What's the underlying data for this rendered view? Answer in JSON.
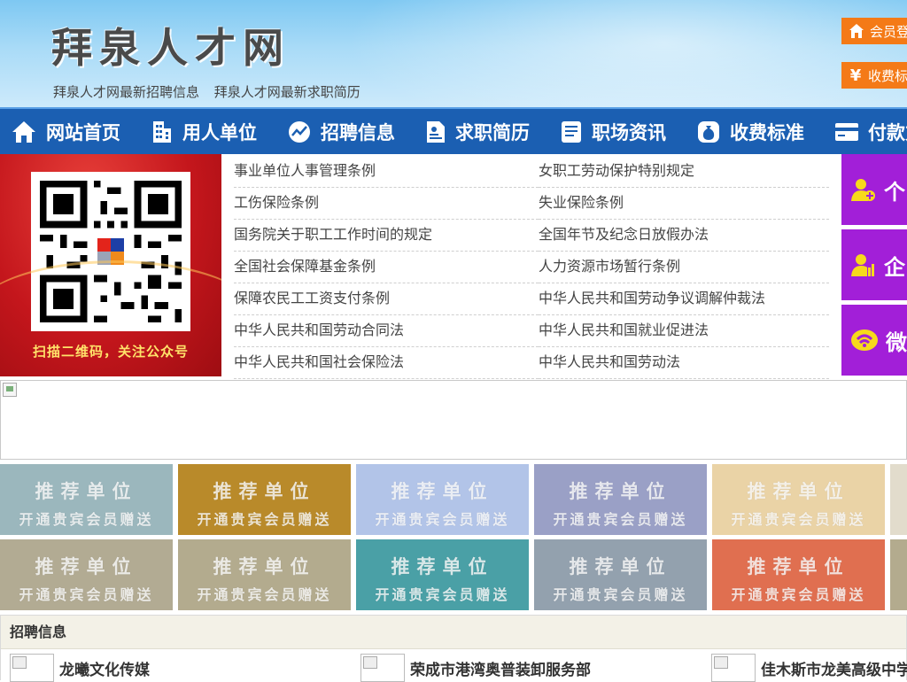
{
  "header": {
    "site_title": "拜泉人才网",
    "links": [
      "拜泉人才网最新招聘信息",
      "拜泉人才网最新求职简历"
    ],
    "login_button": "会员登录",
    "fee_button": "收费标准",
    "fee_icon": "¥"
  },
  "nav": {
    "items": [
      {
        "label": "网站首页",
        "icon": "home-icon"
      },
      {
        "label": "用人单位",
        "icon": "building-icon"
      },
      {
        "label": "招聘信息",
        "icon": "chart-icon"
      },
      {
        "label": "求职简历",
        "icon": "resume-icon"
      },
      {
        "label": "职场资讯",
        "icon": "news-icon"
      },
      {
        "label": "收费标准",
        "icon": "money-bag-icon"
      },
      {
        "label": "付款方式",
        "icon": "card-icon"
      }
    ]
  },
  "qr": {
    "caption": "扫描二维码，关注公众号"
  },
  "laws": [
    "事业单位人事管理条例",
    "女职工劳动保护特别规定",
    "工伤保险条例",
    "失业保险条例",
    "国务院关于职工工作时间的规定",
    "全国年节及纪念日放假办法",
    "全国社会保障基金条例",
    "人力资源市场暂行条例",
    "保障农民工工资支付条例",
    "中华人民共和国劳动争议调解仲裁法",
    "中华人民共和国劳动合同法",
    "中华人民共和国就业促进法",
    "中华人民共和国社会保险法",
    "中华人民共和国劳动法"
  ],
  "side_buttons": [
    {
      "label": "个",
      "icon": "person-add-icon"
    },
    {
      "label": "企",
      "icon": "enterprise-icon"
    },
    {
      "label": "微",
      "icon": "wechat-icon"
    }
  ],
  "recommend": {
    "title": "推荐单位",
    "subtitle": "开通贵宾会员赠送",
    "row1_colors": [
      "#9bb7bd",
      "#b98a2a",
      "#b2c4e8",
      "#9aa0c6",
      "#ead3a6",
      "#e2dccc"
    ],
    "row2_colors": [
      "#b2ab93",
      "#b3ab8e",
      "#4aa0a6",
      "#93a1ae",
      "#e06f50",
      "#b3ab8e"
    ]
  },
  "jobs": {
    "heading": "招聘信息",
    "items": [
      "龙曦文化传媒",
      "荣成市港湾奥普装卸服务部",
      "佳木斯市龙美高级中学"
    ]
  }
}
